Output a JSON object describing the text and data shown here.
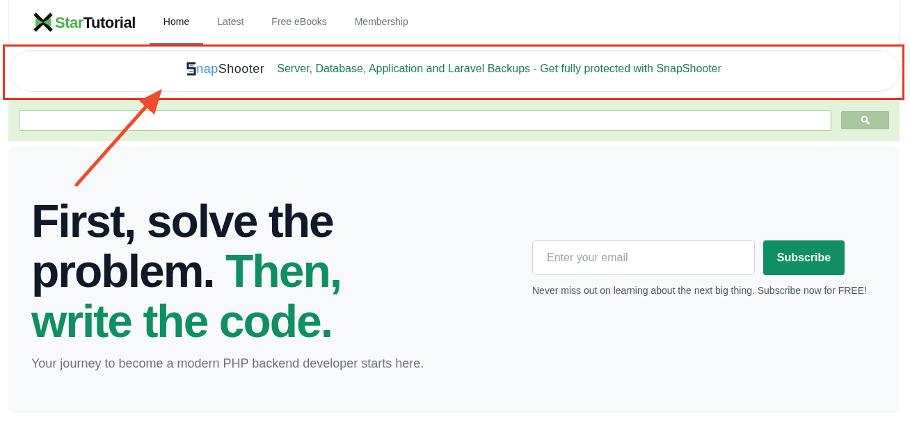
{
  "logo": {
    "part_1": "Star",
    "part_2": "Tutorial"
  },
  "nav": [
    {
      "label": "Home",
      "selected": true
    },
    {
      "label": "Latest",
      "selected": false
    },
    {
      "label": "Free eBooks",
      "selected": false
    },
    {
      "label": "Membership",
      "selected": false
    }
  ],
  "banner": {
    "brand_1": "nap",
    "brand_2": "Shooter",
    "link": "Server, Database, Application and Laravel Backups - Get fully protected with SnapShooter"
  },
  "hero": {
    "headline": [
      {
        "text": "First, solve the problem.",
        "kind": "plain"
      },
      {
        "text": "Then, write the code.",
        "kind": "accent"
      }
    ],
    "tagline": "Your journey to become a modern PHP backend developer starts here.",
    "email_placeholder": "Enter your email",
    "subscribe": "Subscribe",
    "note": "Never miss out on learning about the next big thing. Subscribe now for FREE!"
  }
}
